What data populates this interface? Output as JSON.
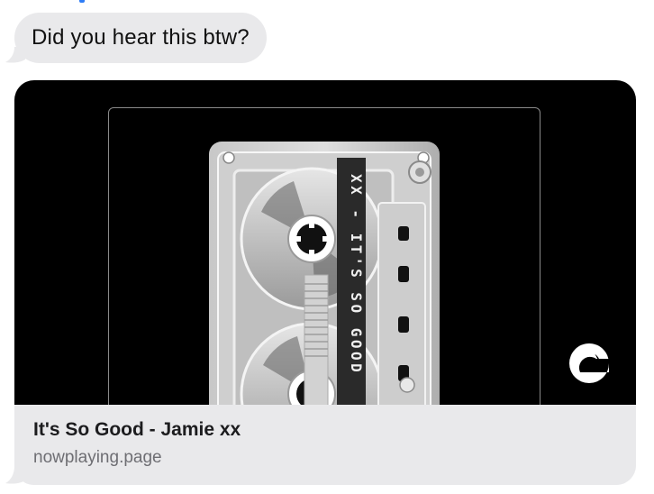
{
  "message": {
    "text": "Did you hear this btw?"
  },
  "link_preview": {
    "title": "It's So Good - Jamie xx",
    "domain": "nowplaying.page",
    "artwork_label": "XX - IT'S SO GOOD",
    "logo_icon": "nowplaying-logo-icon",
    "artwork_icon": "cassette-tape-icon"
  },
  "colors": {
    "bubble_background": "#e9e9eb",
    "artwork_background": "#000000",
    "title_text": "#1c1c1e",
    "domain_text": "#6e6e73"
  }
}
